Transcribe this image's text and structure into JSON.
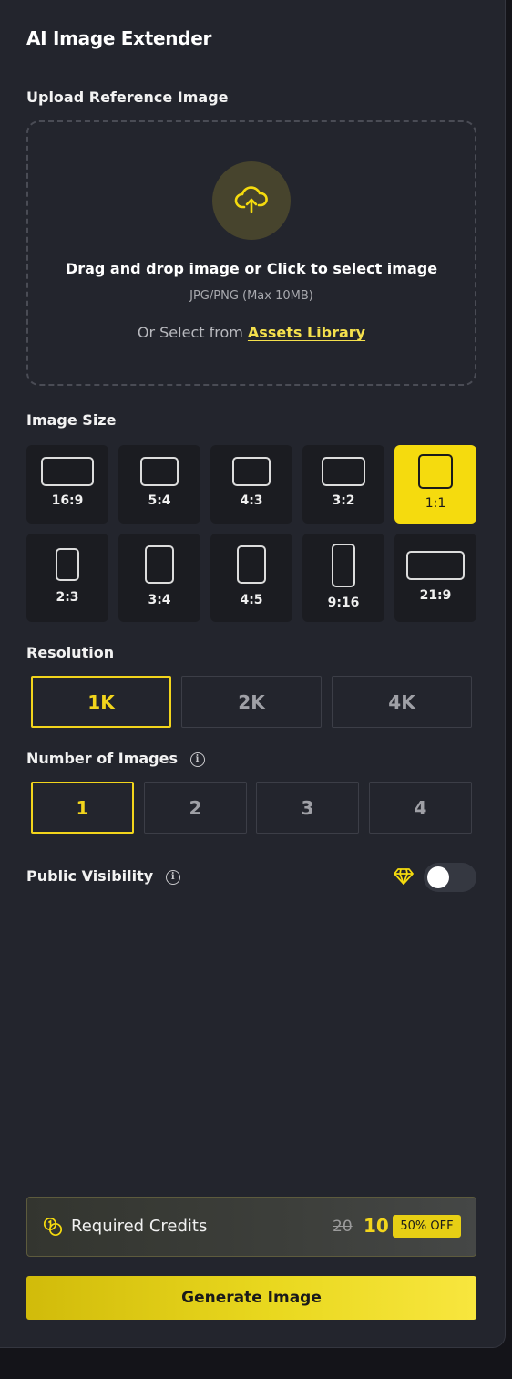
{
  "app": {
    "title": "AI Image Extender"
  },
  "upload": {
    "label": "Upload Reference Image",
    "drop_text": "Drag and drop image or Click to select image",
    "formats": "JPG/PNG (Max 10MB)",
    "or_select": "Or Select from",
    "assets_link": "Assets Library"
  },
  "image_size": {
    "label": "Image Size",
    "options": [
      "16:9",
      "5:4",
      "4:3",
      "3:2",
      "1:1",
      "2:3",
      "3:4",
      "4:5",
      "9:16",
      "21:9"
    ],
    "selected": "1:1"
  },
  "resolution": {
    "label": "Resolution",
    "options": [
      "1K",
      "2K",
      "4K"
    ],
    "selected": "1K"
  },
  "num_images": {
    "label": "Number of Images",
    "options": [
      "1",
      "2",
      "3",
      "4"
    ],
    "selected": "1"
  },
  "visibility": {
    "label": "Public Visibility",
    "toggle_on": false
  },
  "credits": {
    "label": "Required Credits",
    "old_price": "20",
    "new_price": "10",
    "discount": "50% OFF"
  },
  "generate": {
    "label": "Generate Image"
  },
  "colors": {
    "accent": "#f5db0e",
    "panel": "#23252d",
    "background": "#141419"
  }
}
